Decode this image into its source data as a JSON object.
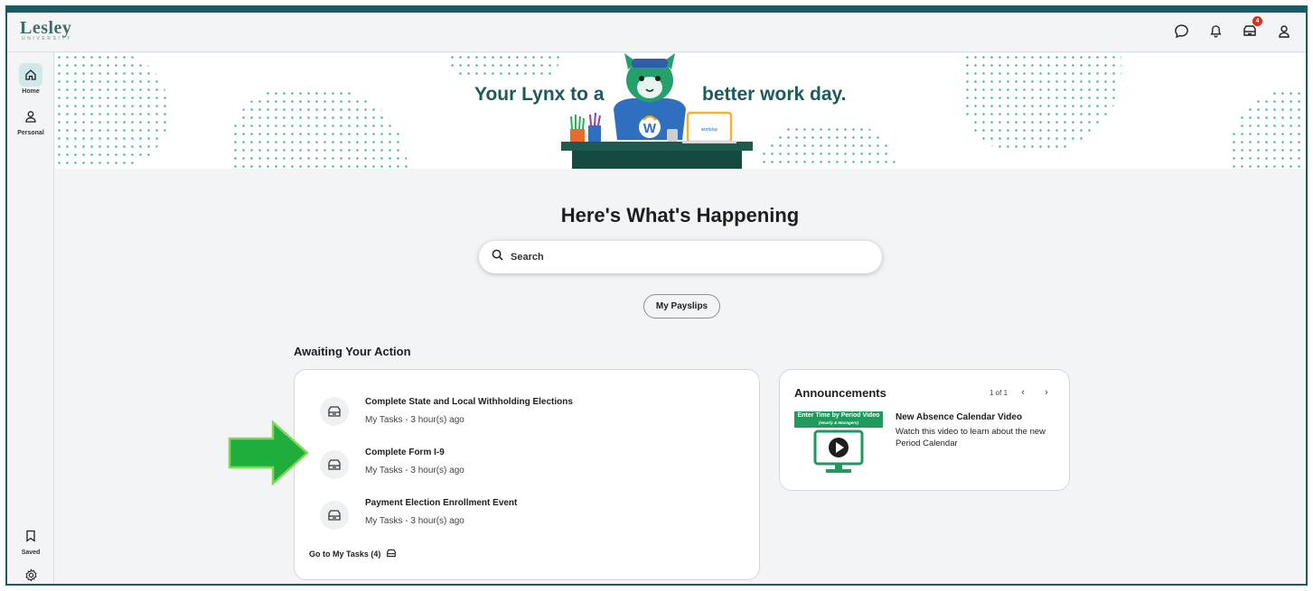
{
  "app": {
    "logo_text": "Lesley",
    "logo_subtext": "UNIVERSITY",
    "notification_count": "4"
  },
  "topbar": {
    "icons": [
      "chat-icon",
      "bell-icon",
      "inbox-icon",
      "profile-icon"
    ]
  },
  "sidebar": {
    "items": [
      {
        "label": "Home",
        "icon": "home-icon"
      },
      {
        "label": "Personal",
        "icon": "person-icon"
      }
    ],
    "bottom_items": [
      {
        "label": "Saved",
        "icon": "bookmark-icon"
      },
      {
        "label": "",
        "icon": "gear-icon"
      }
    ]
  },
  "banner": {
    "left_text": "Your Lynx to a",
    "right_text": "better work day.",
    "colors": {
      "accent": "#1f9a5c",
      "text": "#1e5a58"
    }
  },
  "main": {
    "heading": "Here's What's Happening",
    "search_placeholder": "Search",
    "quick_action": "My Payslips"
  },
  "awaiting": {
    "title": "Awaiting Your Action",
    "tasks": [
      {
        "title": "Complete State and Local Withholding Elections",
        "meta": "My Tasks - 3 hour(s) ago"
      },
      {
        "title": "Complete Form I-9",
        "meta": "My Tasks - 3 hour(s) ago"
      },
      {
        "title": "Payment Election Enrollment Event",
        "meta": "My Tasks - 3 hour(s) ago"
      }
    ],
    "goto_label": "Go to My Tasks (4)"
  },
  "announcements": {
    "title": "Announcements",
    "pager": "1 of 1",
    "item": {
      "thumb_title": "Enter Time by Period Video",
      "thumb_subtitle": "(Hourly & Managers)",
      "title": "New Absence Calendar Video",
      "description": "Watch this video to learn about the new Period Calendar"
    }
  },
  "annotation": {
    "arrow_color": "#1fae3c"
  }
}
